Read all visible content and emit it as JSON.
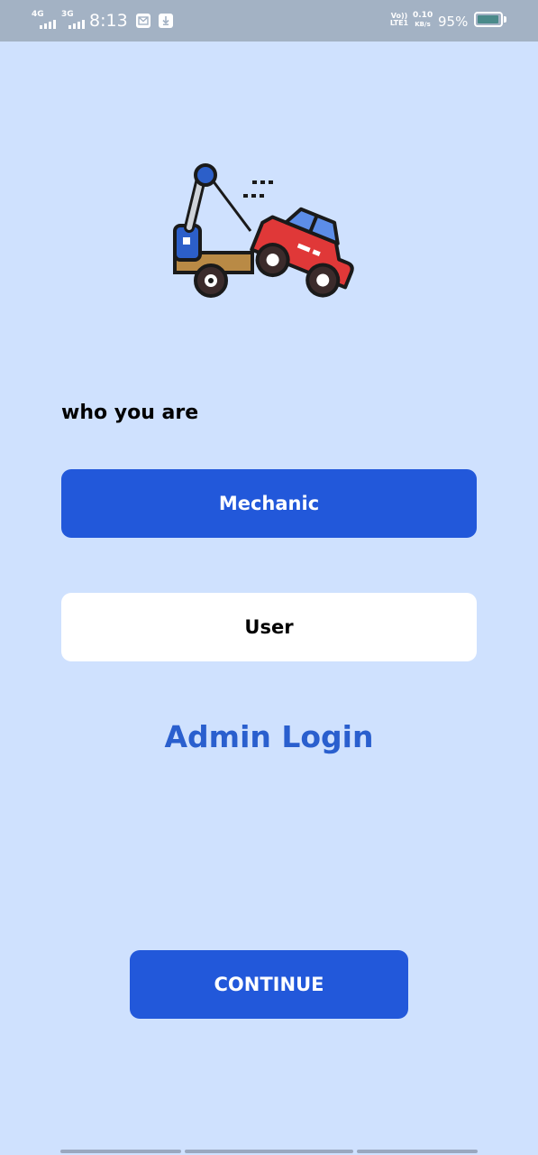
{
  "status_bar": {
    "network_1": "4G",
    "network_2": "3G",
    "time": "8:13",
    "volte": "Vo)) LTE1",
    "speed_value": "0.10",
    "speed_unit": "KB/s",
    "battery_percent": "95%",
    "battery_level": 0.95
  },
  "content": {
    "prompt": "who you are",
    "mechanic_label": "Mechanic",
    "user_label": "User",
    "admin_login_label": "Admin Login",
    "continue_label": "CONTINUE"
  },
  "colors": {
    "background": "#cfe1fe",
    "primary": "#2258da",
    "link": "#2a5fce",
    "status_bar": "#a3b2c4"
  },
  "icons": {
    "hero": "tow-truck-icon"
  }
}
